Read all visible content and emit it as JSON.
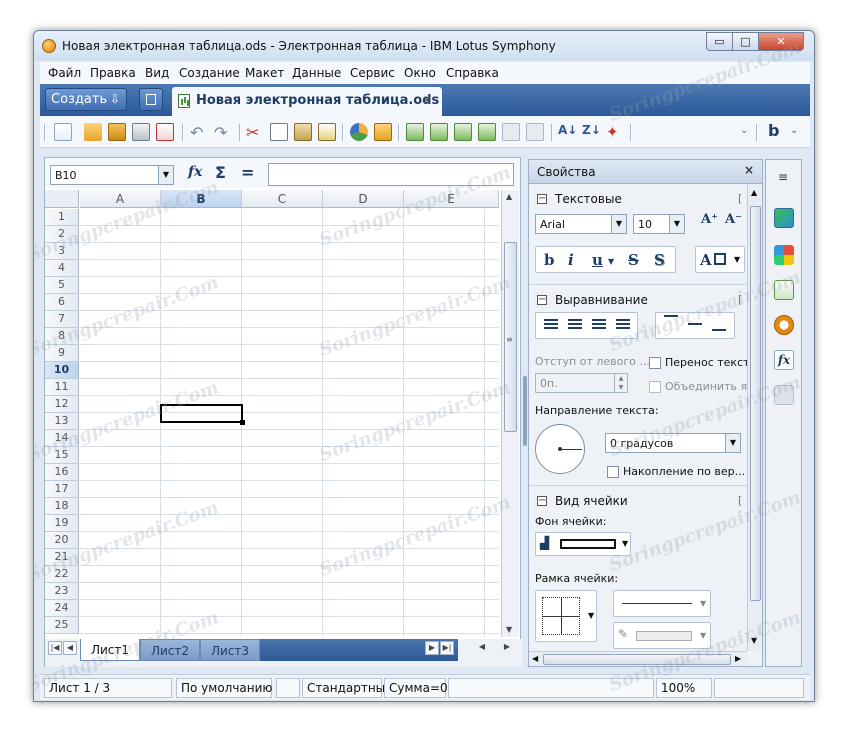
{
  "window": {
    "title": "Новая электронная таблица.ods - Электронная таблица - IBM Lotus Symphony",
    "controls": {
      "minimize": "▭",
      "maximize": "□",
      "close": "✕"
    }
  },
  "menu": [
    "Файл",
    "Правка",
    "Вид",
    "Создание",
    "Макет",
    "Данные",
    "Сервис",
    "Окно",
    "Справка"
  ],
  "tabbar": {
    "create_label": "Создать",
    "document_tab": "Новая электронная таблица.ods",
    "close_glyph": "×"
  },
  "formula_bar": {
    "cell_ref": "B10",
    "fx": "fx",
    "sum": "Σ",
    "equals": "=",
    "formula": ""
  },
  "sheet": {
    "columns": [
      "A",
      "B",
      "C",
      "D",
      "E"
    ],
    "selected_column": "B",
    "rows": [
      "1",
      "2",
      "3",
      "4",
      "5",
      "6",
      "7",
      "8",
      "9",
      "10",
      "11",
      "12",
      "13",
      "14",
      "15",
      "16",
      "17",
      "18",
      "19",
      "20",
      "21",
      "22",
      "23",
      "24",
      "25"
    ],
    "selected_row": "10",
    "tabs": [
      "Лист1",
      "Лист2",
      "Лист3"
    ],
    "active_tab": "Лист1"
  },
  "properties": {
    "title": "Свойства",
    "close": "×",
    "text_section": {
      "label": "Текстовые",
      "font": "Arial",
      "size": "10",
      "grow": "A⁺",
      "shrink": "A⁻",
      "bold": "b",
      "italic": "i",
      "underline": "u",
      "strike": "S",
      "shadow": "S",
      "font_color": "A"
    },
    "align_section": {
      "label": "Выравнивание",
      "indent_label": "Отступ от левого ...",
      "indent_value": "0п.",
      "wrap_label": "Перенос текст",
      "merge_label": "Объединить яч",
      "direction_label": "Направление текста:",
      "rotation": "0 градусов",
      "stack_label": "Накопление по вер..."
    },
    "cell_section": {
      "label": "Вид ячейки",
      "bg_label": "Фон ячейки:",
      "border_label": "Рамка ячейки:"
    }
  },
  "statusbar": {
    "sheet": "Лист 1 / 3",
    "style": "По умолчанию",
    "mode": "Стандартный",
    "sum": "Сумма=0",
    "zoom": "100%"
  },
  "watermark": "Soringpcrepair.Com",
  "colors": {
    "tabbar": "#2b5899",
    "accent": "#1d3c66",
    "close": "#c7442b"
  }
}
